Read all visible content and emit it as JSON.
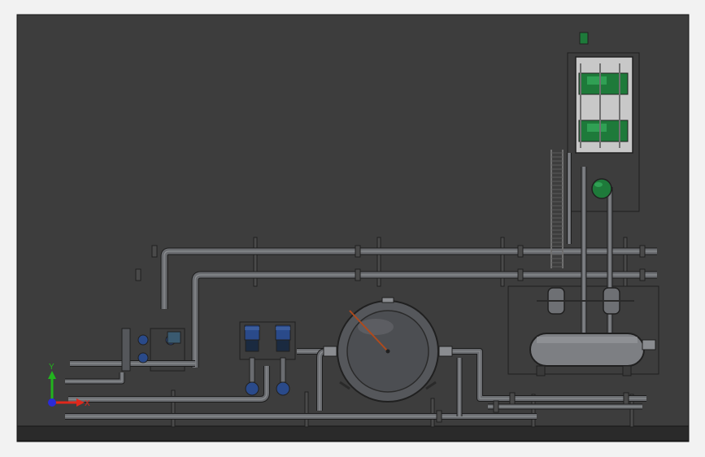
{
  "viewport": {
    "background": "#3d3d3d",
    "frame_color": "#161616",
    "page_color": "#f2f2f2"
  },
  "triad": {
    "x_label": "X",
    "y_label": "Y",
    "x_color": "#e0281c",
    "y_color": "#22b41e",
    "z_color": "#2a2ad8"
  },
  "colors": {
    "pipe": "#6a6c70",
    "pipe_highlight": "#9a9ca0",
    "pipe_edge": "#1c1c1c",
    "steel": "#8a8c90",
    "steel_light": "#c8c8c8",
    "motor_blue": "#2a4a8a",
    "motor_dark": "#1a2a40",
    "pump_green": "#1e7a3a",
    "pump_green_light": "#38b060",
    "needle": "#b04a1c",
    "dark_stroke": "#202020"
  },
  "components": {
    "vessel": "spherical-tank",
    "tank": "horizontal-tank",
    "pump_pair": "twin-vertical-pumps",
    "skid": "upper-equipment-skid",
    "ladder": "ladder",
    "left_manifold": "left-pump-manifold"
  }
}
